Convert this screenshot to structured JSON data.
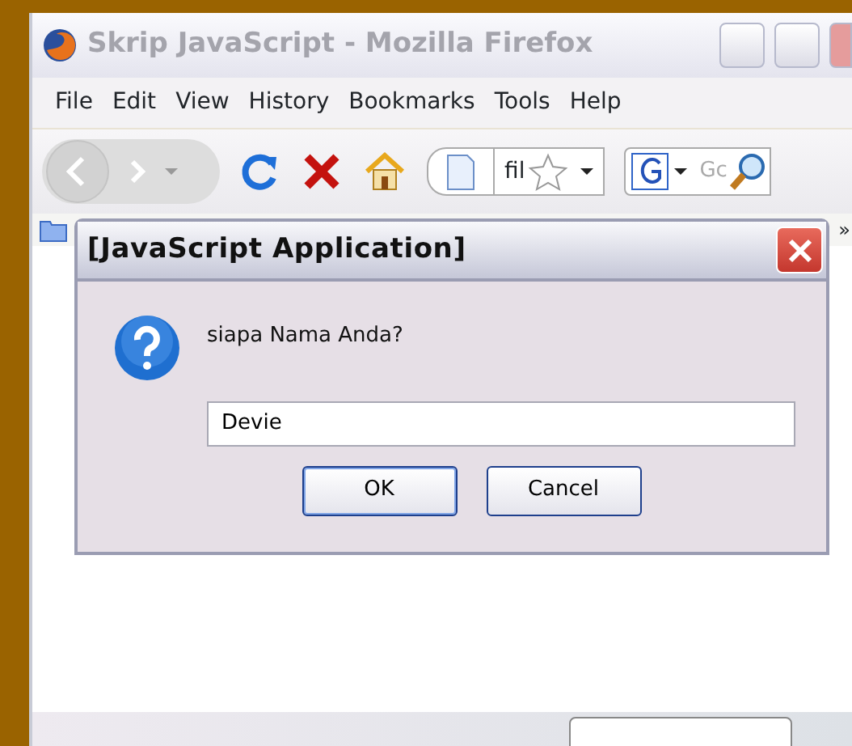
{
  "window": {
    "title": "Skrip JavaScript - Mozilla Firefox"
  },
  "menu": [
    "File",
    "Edit",
    "View",
    "History",
    "Bookmarks",
    "Tools",
    "Help"
  ],
  "navigation": {
    "address": "fil",
    "search": "Gc"
  },
  "bookmarks_toolbar": {
    "overflow": "»"
  },
  "dialog": {
    "title": "[JavaScript Application]",
    "message": "siapa Nama Anda?",
    "input_value": "Devie",
    "buttons": [
      {
        "label": "OK",
        "default": true
      },
      {
        "label": "Cancel",
        "default": false
      }
    ]
  }
}
